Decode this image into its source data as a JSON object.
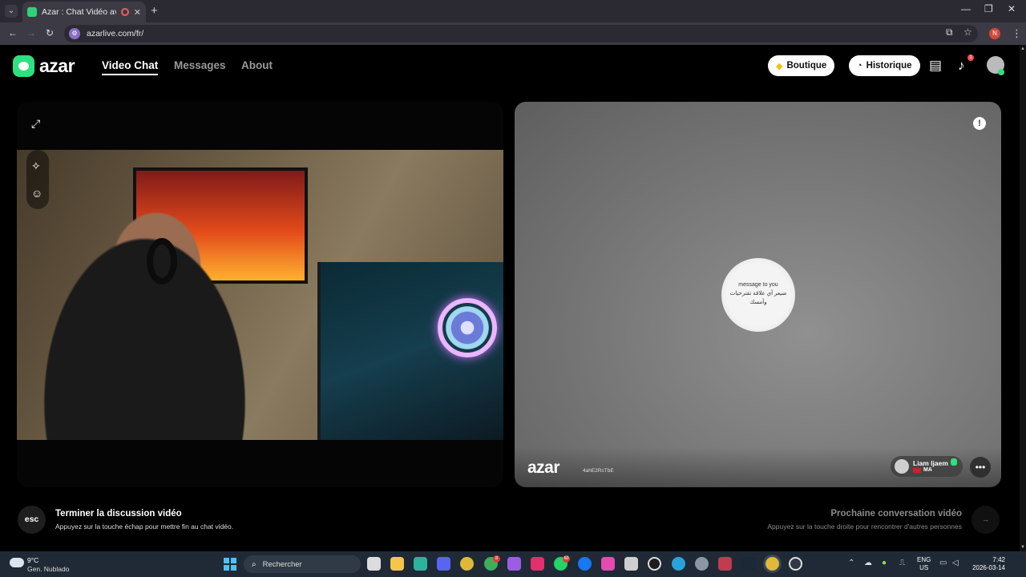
{
  "browser": {
    "tab_title": "Azar : Chat Vidéo avec de n",
    "url": "azarlive.com/fr/",
    "profile_initial": "N"
  },
  "site": {
    "logo_text": "azar",
    "nav": [
      {
        "label": "Video Chat",
        "active": true
      },
      {
        "label": "Messages",
        "active": false
      },
      {
        "label": "About",
        "active": false
      }
    ],
    "shop_label": "Boutique",
    "history_label": "Historique",
    "notification_count": "1"
  },
  "remote": {
    "watermark": "azar",
    "stream_id": "4ahE2RcTbE",
    "peer_name": "Liam ljaem",
    "peer_country": "MA",
    "spinner_lines": [
      "message to you",
      "ضيعر أي علاقة تقترحيات وأمسك"
    ]
  },
  "actions": {
    "esc_key": "esc",
    "end_title": "Terminer la discussion vidéo",
    "end_sub": "Appuyez sur la touche échap pour mettre fin au chat vidéo.",
    "next_title": "Prochaine conversation vidéo",
    "next_sub": "Appuyez sur la touche droite pour rencontrer d'autres personnes",
    "next_key": "→"
  },
  "taskbar": {
    "temp": "9°C",
    "weather": "Gen. Nublado",
    "search_placeholder": "Rechercher",
    "lang_top": "ENG",
    "lang_bottom": "US",
    "time": "7:42",
    "date": "2026-03-14",
    "badges": {
      "chrome": "8",
      "whatsapp": "60"
    }
  },
  "colors": {
    "brand_green": "#2ee07f",
    "badge_red": "#ff4757",
    "taskbar_bg": "#1f2a36"
  }
}
